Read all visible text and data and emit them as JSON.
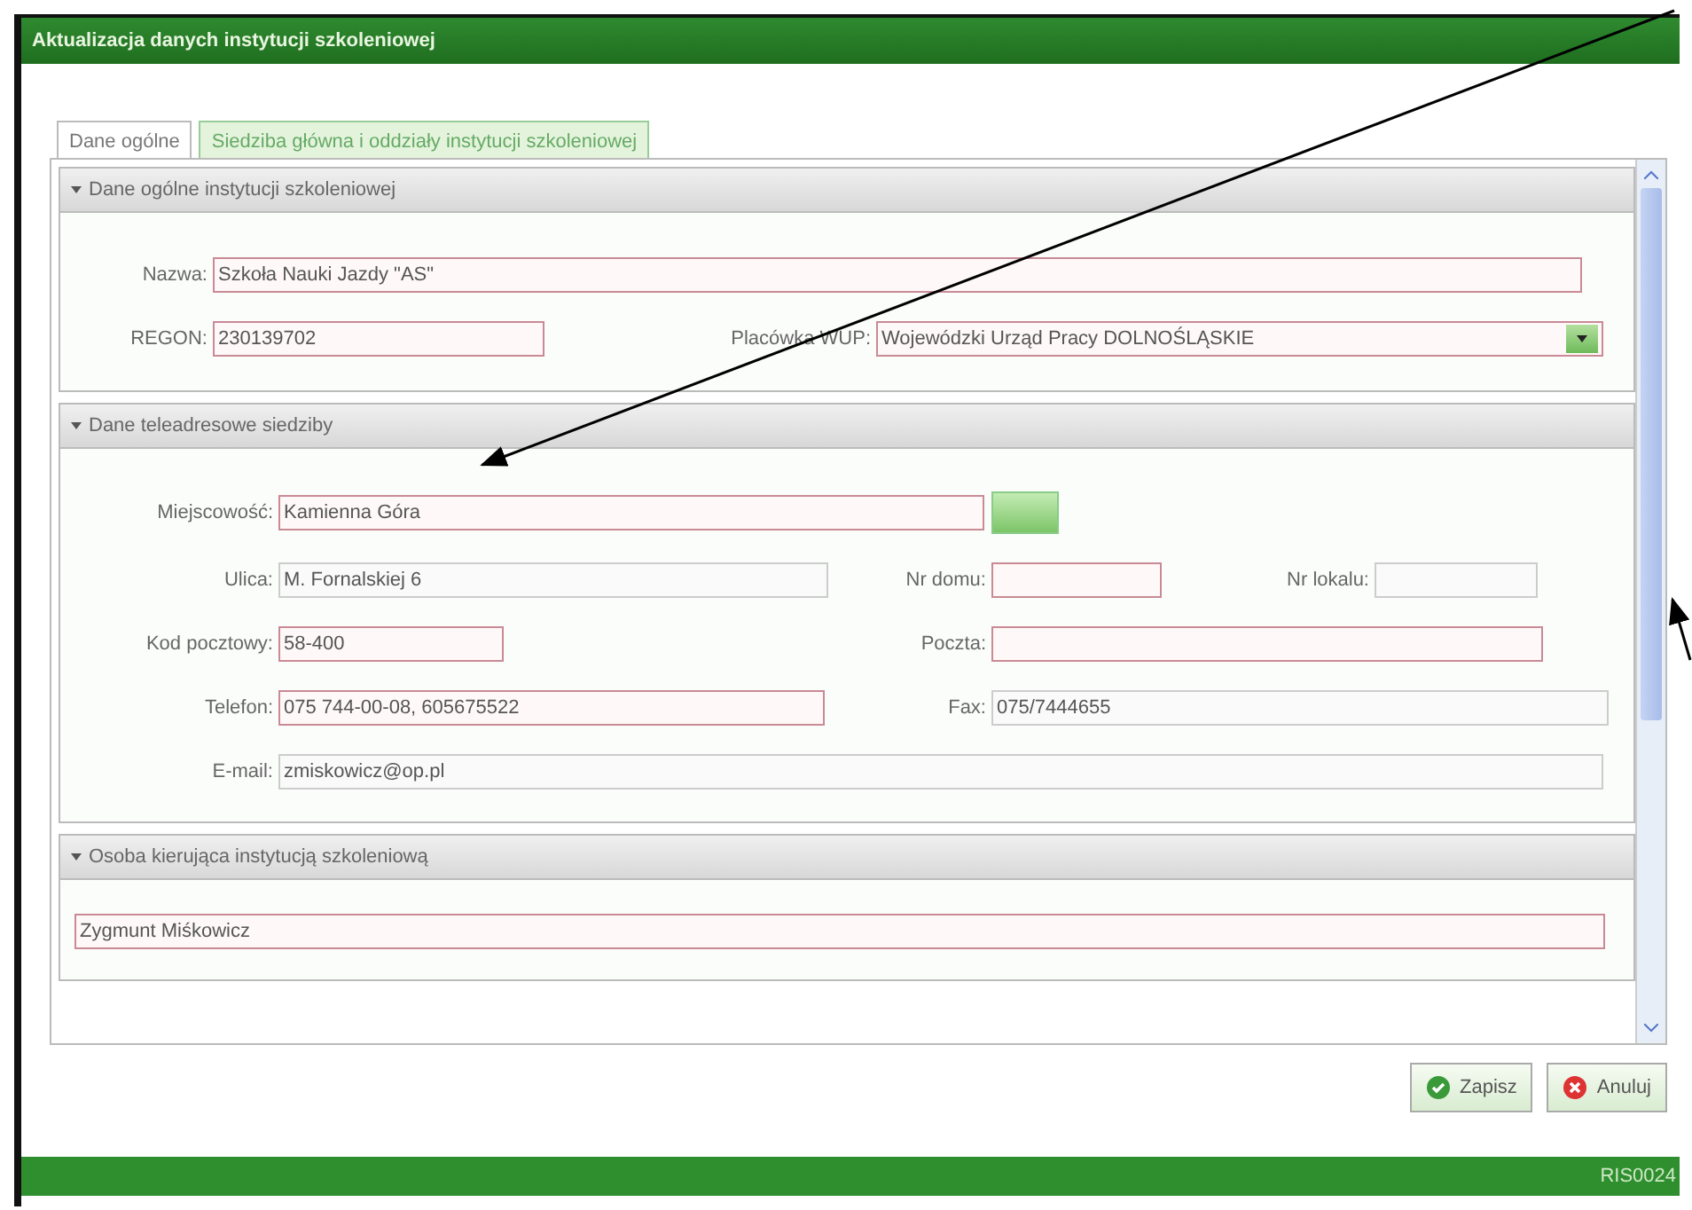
{
  "window": {
    "title": "Aktualizacja danych instytucji szkoleniowej"
  },
  "tabs": [
    {
      "label": "Dane ogólne",
      "selected": true
    },
    {
      "label": "Siedziba główna i oddziały instytucji szkoleniowej",
      "selected": false
    }
  ],
  "sections": [
    {
      "title": "Dane ogólne instytucji szkoleniowej",
      "expanded": true,
      "fields": [
        {
          "label": "Nazwa:",
          "value": "Szkoła Nauki Jazdy \"AS\"",
          "required": true,
          "kind": "text"
        },
        {
          "label": "REGON:",
          "value": "230139702",
          "required": true,
          "kind": "text"
        },
        {
          "label": "Placówka WUP:",
          "value": "Wojewódzki Urząd Pracy DOLNOŚLĄSKIE",
          "required": true,
          "kind": "select"
        }
      ]
    },
    {
      "title": "Dane teleadresowe siedziby",
      "expanded": true,
      "fields": [
        {
          "label": "Miejscowość:",
          "value": "Kamienna Góra",
          "required": true,
          "kind": "lookup"
        },
        {
          "label": "Ulica:",
          "value": "M. Fornalskiej 6",
          "required": false,
          "kind": "text"
        },
        {
          "label": "Nr domu:",
          "required": true,
          "kind": "text"
        },
        {
          "label": "Nr lokalu:",
          "required": false,
          "kind": "text"
        },
        {
          "label": "Kod pocztowy:",
          "value": "58-400",
          "required": true,
          "kind": "text"
        },
        {
          "label": "Poczta:",
          "required": true,
          "kind": "text"
        },
        {
          "label": "Telefon:",
          "value": "075 744-00-08, 605675522",
          "required": true,
          "kind": "text"
        },
        {
          "label": "Fax:",
          "value": "075/7444655",
          "required": false,
          "kind": "text"
        },
        {
          "label": "E-mail:",
          "value": "zmiskowicz@op.pl",
          "required": false,
          "kind": "text"
        }
      ]
    },
    {
      "title": "Osoba kierująca instytucją szkoleniową",
      "expanded": true,
      "fields": [
        {
          "value": "Zygmunt Miśkowicz",
          "required": true,
          "kind": "text"
        }
      ]
    }
  ],
  "buttons": [
    {
      "label": "Zapisz",
      "kind": "save"
    },
    {
      "label": "Anuluj",
      "kind": "cancel"
    }
  ],
  "status_bar": {
    "code": "RIS0024"
  }
}
